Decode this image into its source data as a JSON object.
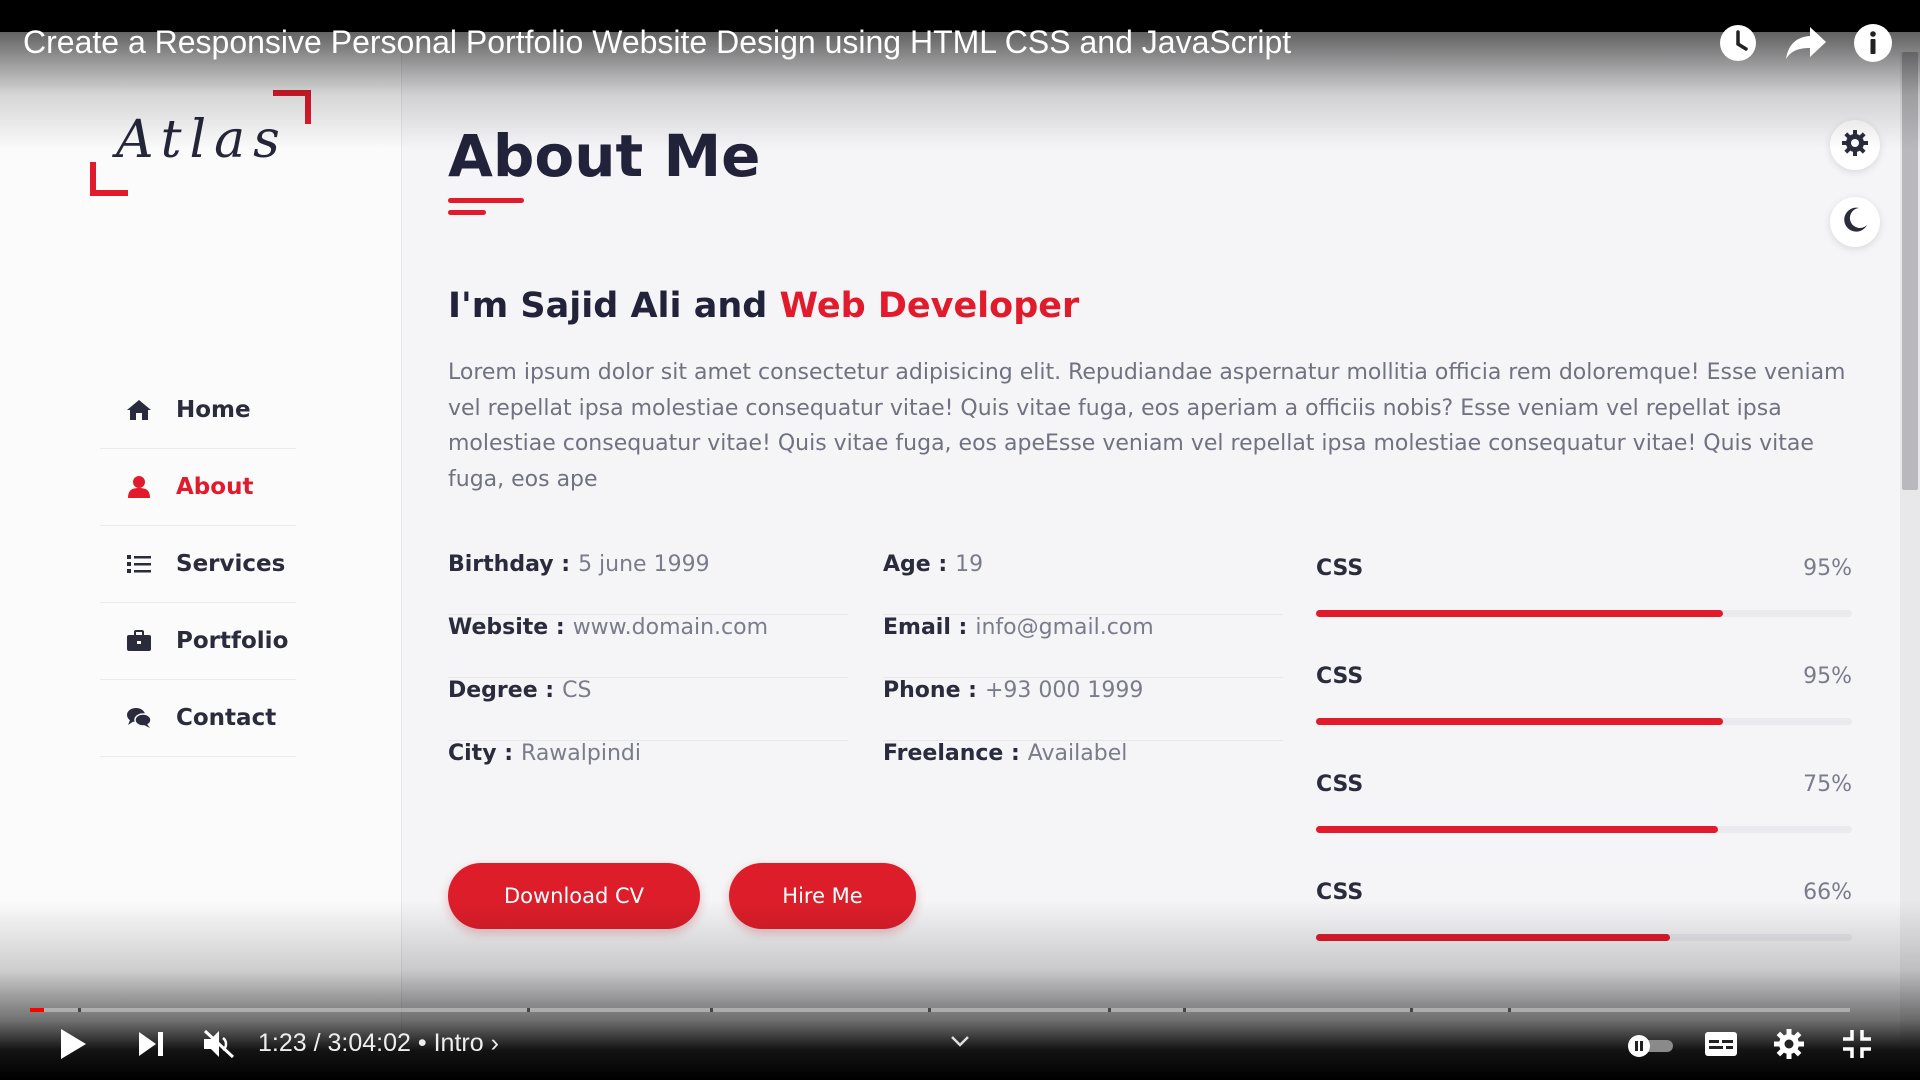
{
  "video": {
    "title": "Create a Responsive Personal Portfolio Website Design using HTML CSS and JavaScript",
    "time_current": "1:23",
    "time_total": "3:04:02",
    "chapter": "Intro",
    "progress_fraction": 0.0075,
    "accent_color": "#ff0000",
    "icons": [
      "watch-later-icon",
      "share-icon",
      "info-icon",
      "play-icon",
      "next-icon",
      "mute-icon",
      "chevron-down-icon",
      "autoplay-toggle",
      "subtitles-icon",
      "settings-icon",
      "exit-fullscreen-icon"
    ]
  },
  "site": {
    "logo": "Atlas",
    "brand_color": "#e21b2c",
    "nav": [
      {
        "label": "Home",
        "icon": "home-icon",
        "active": false
      },
      {
        "label": "About",
        "icon": "user-icon",
        "active": true
      },
      {
        "label": "Services",
        "icon": "list-icon",
        "active": false
      },
      {
        "label": "Portfolio",
        "icon": "briefcase-icon",
        "active": false
      },
      {
        "label": "Contact",
        "icon": "comments-icon",
        "active": false
      }
    ],
    "page_title": "About Me",
    "heading_prefix": "I'm Sajid Ali and ",
    "heading_accent": "Web Developer",
    "paragraph": "Lorem ipsum dolor sit amet consectetur adipisicing elit. Repudiandae aspernatur mollitia officia rem doloremque! Esse veniam vel repellat ipsa molestiae consequatur vitae! Quis vitae fuga, eos aperiam a officiis nobis? Esse veniam vel repellat ipsa molestiae consequatur vitae! Quis vitae fuga, eos apeEsse veniam vel repellat ipsa molestiae consequatur vitae! Quis vitae fuga, eos ape",
    "info": [
      {
        "key": "Birthday :",
        "value": "5 june 1999"
      },
      {
        "key": "Age :",
        "value": "19"
      },
      {
        "key": "Website :",
        "value": "www.domain.com"
      },
      {
        "key": "Email :",
        "value": "info@gmail.com"
      },
      {
        "key": "Degree :",
        "value": "CS"
      },
      {
        "key": "Phone :",
        "value": "+93 000 1999"
      },
      {
        "key": "City :",
        "value": "Rawalpindi"
      },
      {
        "key": "Freelance :",
        "value": "Availabel"
      }
    ],
    "buttons": {
      "download": "Download CV",
      "hire": "Hire Me"
    },
    "skills": [
      {
        "name": "CSS",
        "percent_label": "95%",
        "level": 0.76
      },
      {
        "name": "CSS",
        "percent_label": "95%",
        "level": 0.76
      },
      {
        "name": "CSS",
        "percent_label": "75%",
        "level": 0.75
      },
      {
        "name": "CSS",
        "percent_label": "66%",
        "level": 0.66
      }
    ],
    "side_icons": [
      "gear-icon",
      "moon-icon"
    ]
  }
}
